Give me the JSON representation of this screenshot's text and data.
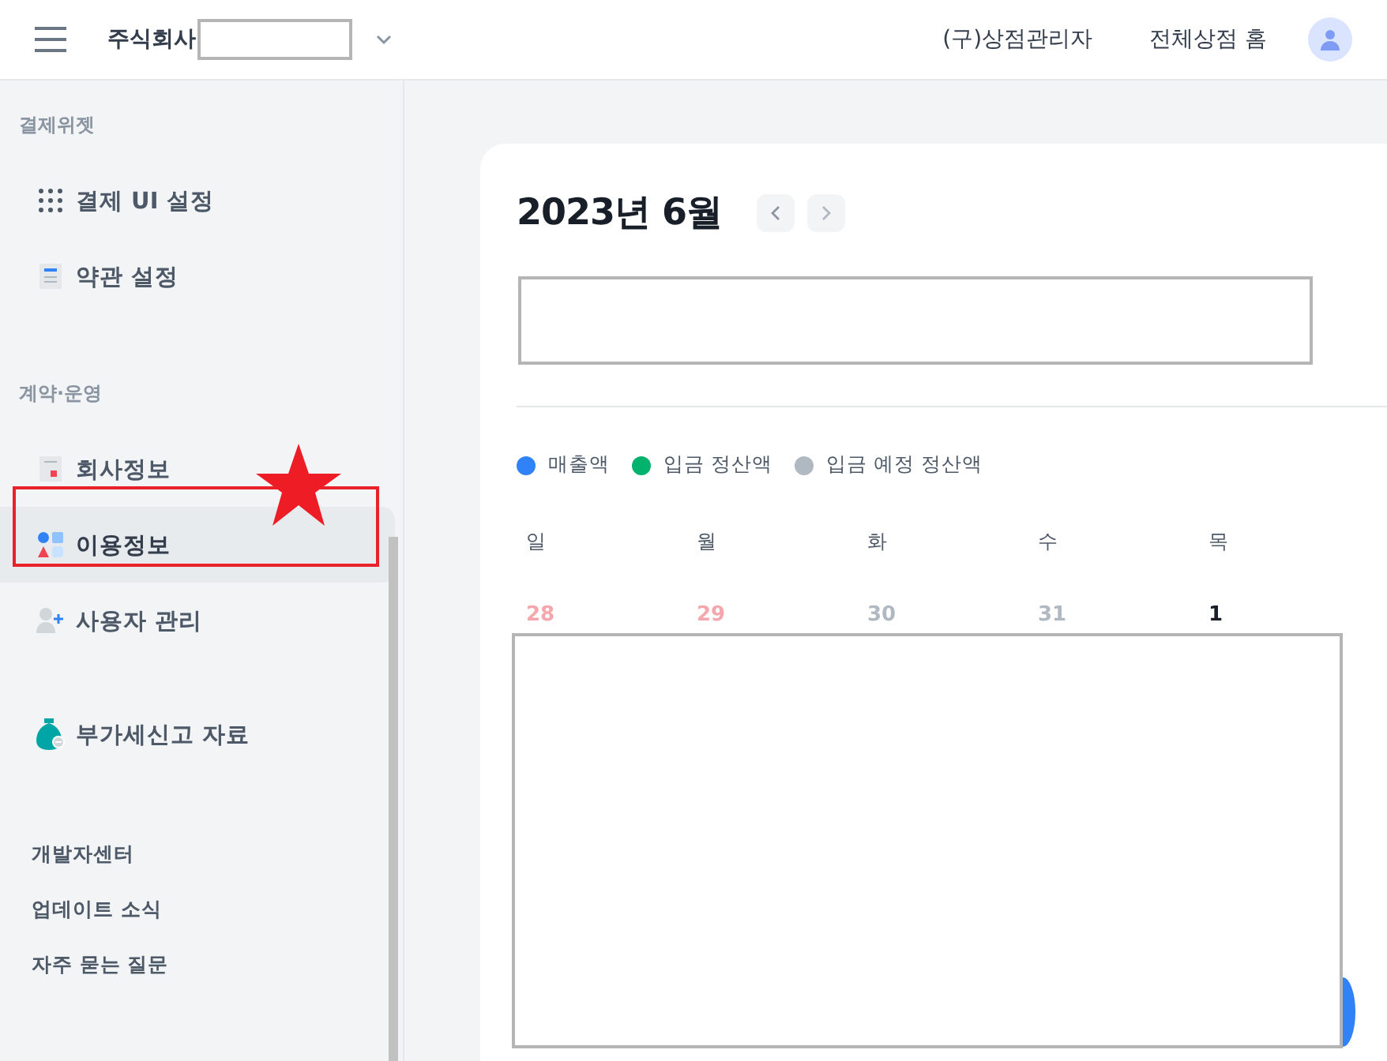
{
  "header": {
    "company": "주식회사",
    "admin_label": "(구)상점관리자",
    "home_link": "전체상점 홈"
  },
  "sidebar": {
    "sections": [
      {
        "title": "결제위젯",
        "items": [
          {
            "label": "결제 UI 설정",
            "selected": false
          },
          {
            "label": "약관 설정",
            "selected": false
          }
        ]
      },
      {
        "title": "계약·운영",
        "items": [
          {
            "label": "회사정보",
            "selected": false
          },
          {
            "label": "이용정보",
            "selected": true
          },
          {
            "label": "사용자 관리",
            "selected": false
          },
          {
            "label": "부가세신고 자료",
            "selected": false
          }
        ]
      }
    ],
    "links": [
      "개발자센터",
      "업데이트 소식",
      "자주 묻는 질문"
    ]
  },
  "calendar": {
    "title": "2023년 6월",
    "legend": [
      {
        "label": "매출액",
        "color": "#3182f6"
      },
      {
        "label": "입금 정산액",
        "color": "#03b26c"
      },
      {
        "label": "입금 예정 정산액",
        "color": "#b0b8c1"
      }
    ],
    "weekdays": [
      "일",
      "월",
      "화",
      "수",
      "목"
    ],
    "dates": [
      {
        "day": "28",
        "other_month": true,
        "holiday": true
      },
      {
        "day": "29",
        "other_month": true,
        "holiday": true
      },
      {
        "day": "30",
        "other_month": true,
        "holiday": false
      },
      {
        "day": "31",
        "other_month": true,
        "holiday": false
      },
      {
        "day": "1",
        "other_month": false,
        "holiday": false
      }
    ]
  }
}
